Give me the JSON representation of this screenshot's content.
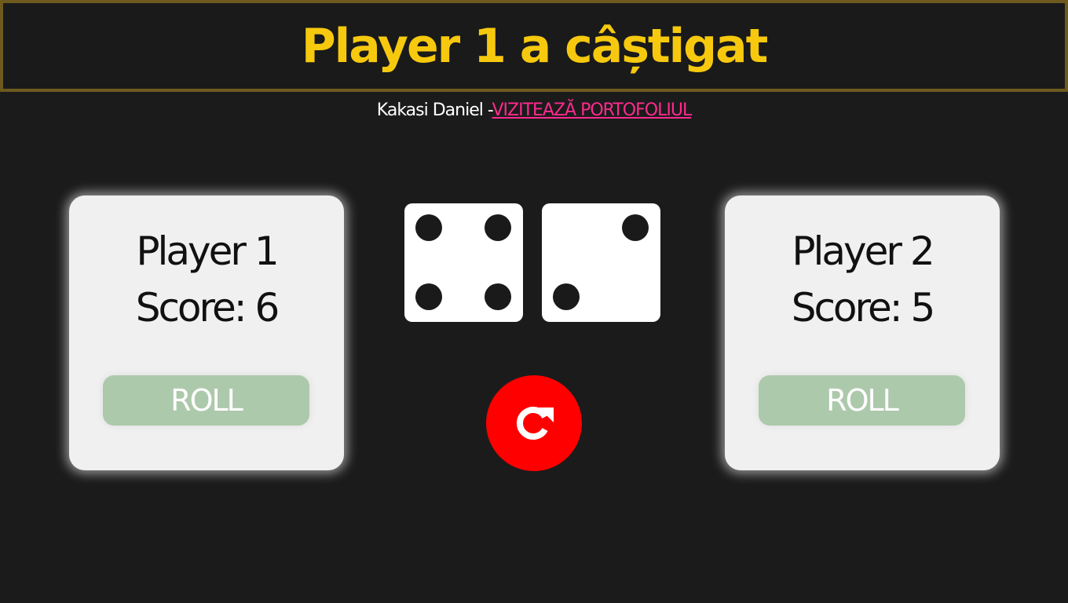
{
  "header": {
    "title": "Player 1 a câștigat",
    "title_color": "#f6c90e"
  },
  "credit": {
    "author": "Kakasi Daniel -",
    "link_label": "VIZITEAZĂ PORTOFOLIUL",
    "link_color": "#ff2a8e"
  },
  "players": [
    {
      "name": "Player 1",
      "score_text": "Score: 6",
      "roll_label": "ROLL"
    },
    {
      "name": "Player 2",
      "score_text": "Score: 5",
      "roll_label": "ROLL"
    }
  ],
  "dice": [
    {
      "value": 4
    },
    {
      "value": 2
    }
  ],
  "reset": {
    "icon": "refresh-icon",
    "color": "#ff0000"
  }
}
